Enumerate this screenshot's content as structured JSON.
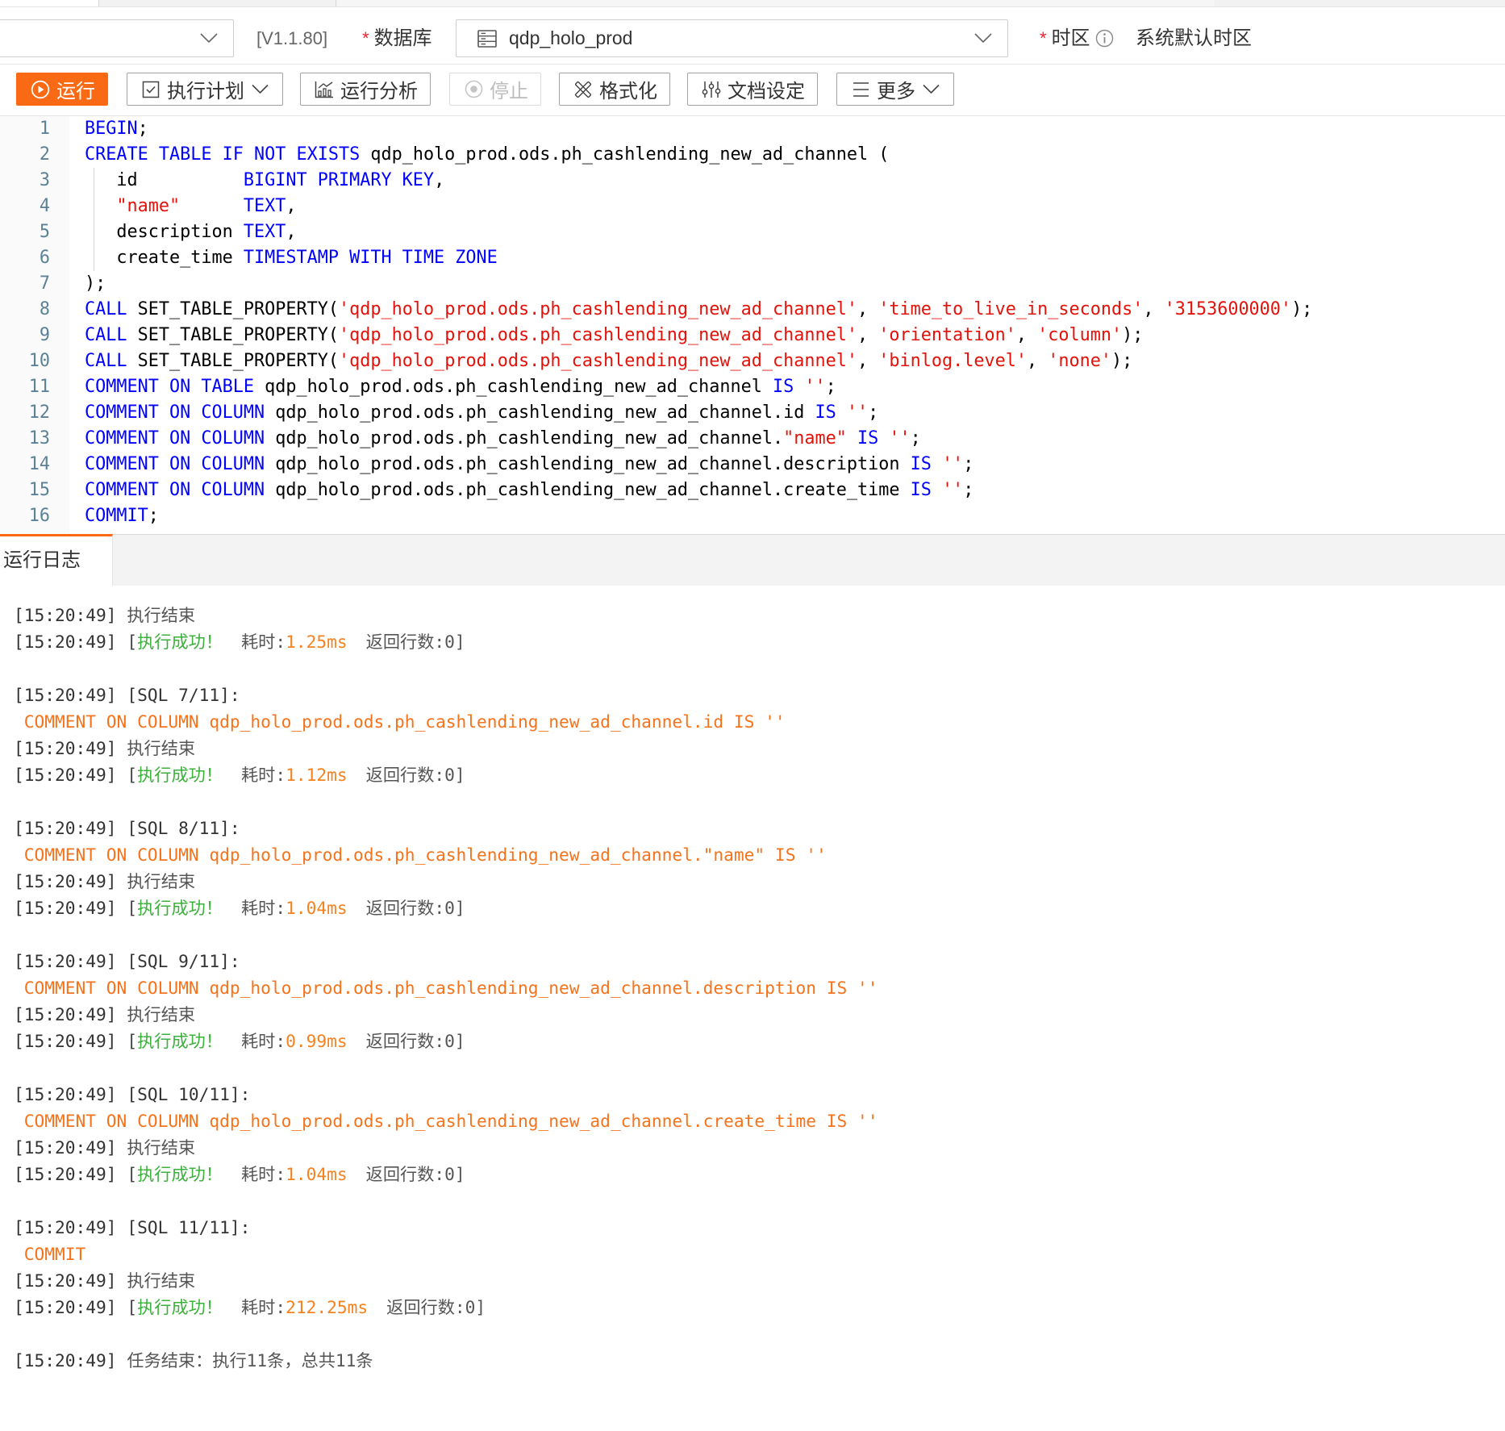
{
  "header": {
    "project_select": {
      "value": ""
    },
    "version": "[V1.1.80]",
    "database": {
      "required_mark": "*",
      "label": "数据库",
      "value": "qdp_holo_prod",
      "icon": "database-icon"
    },
    "timezone": {
      "required_mark": "*",
      "label": "时区",
      "info_icon": "info-icon",
      "value": "系统默认时区"
    }
  },
  "toolbar": {
    "run": {
      "label": "运行",
      "icon": "play-circle-icon"
    },
    "plan": {
      "label": "执行计划",
      "icon": "checkbox-icon"
    },
    "analyze": {
      "label": "运行分析",
      "icon": "chart-icon"
    },
    "stop": {
      "label": "停止",
      "icon": "stop-circle-icon",
      "disabled": true
    },
    "format": {
      "label": "格式化",
      "icon": "format-icon"
    },
    "doc_settings": {
      "label": "文档设定",
      "icon": "sliders-icon"
    },
    "more": {
      "label": "更多",
      "icon": "menu-icon"
    }
  },
  "editor": {
    "lines": [
      {
        "n": 1,
        "tokens": [
          {
            "k": "BEGIN"
          },
          {
            "t": ";"
          }
        ]
      },
      {
        "n": 2,
        "tokens": [
          {
            "k": "CREATE TABLE IF NOT EXISTS"
          },
          {
            "t": " qdp_holo_prod.ods.ph_cashlending_new_ad_channel ("
          }
        ]
      },
      {
        "n": 3,
        "tokens": [
          {
            "t": "   id          "
          },
          {
            "k": "BIGINT PRIMARY KEY"
          },
          {
            "t": ","
          }
        ]
      },
      {
        "n": 4,
        "tokens": [
          {
            "t": "   "
          },
          {
            "s": "\"name\""
          },
          {
            "t": "      "
          },
          {
            "k": "TEXT"
          },
          {
            "t": ","
          }
        ]
      },
      {
        "n": 5,
        "tokens": [
          {
            "t": "   description "
          },
          {
            "k": "TEXT"
          },
          {
            "t": ","
          }
        ]
      },
      {
        "n": 6,
        "tokens": [
          {
            "t": "   create_time "
          },
          {
            "k": "TIMESTAMP WITH TIME ZONE"
          }
        ]
      },
      {
        "n": 7,
        "tokens": [
          {
            "t": ");"
          }
        ]
      },
      {
        "n": 8,
        "tokens": [
          {
            "k": "CALL"
          },
          {
            "t": " SET_TABLE_PROPERTY("
          },
          {
            "s": "'qdp_holo_prod.ods.ph_cashlending_new_ad_channel'"
          },
          {
            "t": ", "
          },
          {
            "s": "'time_to_live_in_seconds'"
          },
          {
            "t": ", "
          },
          {
            "s": "'3153600000'"
          },
          {
            "t": ");"
          }
        ]
      },
      {
        "n": 9,
        "tokens": [
          {
            "k": "CALL"
          },
          {
            "t": " SET_TABLE_PROPERTY("
          },
          {
            "s": "'qdp_holo_prod.ods.ph_cashlending_new_ad_channel'"
          },
          {
            "t": ", "
          },
          {
            "s": "'orientation'"
          },
          {
            "t": ", "
          },
          {
            "s": "'column'"
          },
          {
            "t": ");"
          }
        ]
      },
      {
        "n": 10,
        "tokens": [
          {
            "k": "CALL"
          },
          {
            "t": " SET_TABLE_PROPERTY("
          },
          {
            "s": "'qdp_holo_prod.ods.ph_cashlending_new_ad_channel'"
          },
          {
            "t": ", "
          },
          {
            "s": "'binlog.level'"
          },
          {
            "t": ", "
          },
          {
            "s": "'none'"
          },
          {
            "t": ");"
          }
        ]
      },
      {
        "n": 11,
        "tokens": [
          {
            "k": "COMMENT ON TABLE"
          },
          {
            "t": " qdp_holo_prod.ods.ph_cashlending_new_ad_channel "
          },
          {
            "k": "IS"
          },
          {
            "t": " "
          },
          {
            "s": "''"
          },
          {
            "t": ";"
          }
        ]
      },
      {
        "n": 12,
        "tokens": [
          {
            "k": "COMMENT ON COLUMN"
          },
          {
            "t": " qdp_holo_prod.ods.ph_cashlending_new_ad_channel.id "
          },
          {
            "k": "IS"
          },
          {
            "t": " "
          },
          {
            "s": "''"
          },
          {
            "t": ";"
          }
        ]
      },
      {
        "n": 13,
        "tokens": [
          {
            "k": "COMMENT ON COLUMN"
          },
          {
            "t": " qdp_holo_prod.ods.ph_cashlending_new_ad_channel."
          },
          {
            "s": "\"name\""
          },
          {
            "t": " "
          },
          {
            "k": "IS"
          },
          {
            "t": " "
          },
          {
            "s": "''"
          },
          {
            "t": ";"
          }
        ]
      },
      {
        "n": 14,
        "tokens": [
          {
            "k": "COMMENT ON COLUMN"
          },
          {
            "t": " qdp_holo_prod.ods.ph_cashlending_new_ad_channel.description "
          },
          {
            "k": "IS"
          },
          {
            "t": " "
          },
          {
            "s": "''"
          },
          {
            "t": ";"
          }
        ]
      },
      {
        "n": 15,
        "tokens": [
          {
            "k": "COMMENT ON COLUMN"
          },
          {
            "t": " qdp_holo_prod.ods.ph_cashlending_new_ad_channel.create_time "
          },
          {
            "k": "IS"
          },
          {
            "t": " "
          },
          {
            "s": "''"
          },
          {
            "t": ";"
          }
        ]
      },
      {
        "n": 16,
        "tokens": [
          {
            "k": "COMMIT"
          },
          {
            "t": ";"
          }
        ]
      }
    ]
  },
  "log_panel": {
    "tab_label": "运行日志",
    "entries": [
      {
        "time": "[15:20:49]",
        "msg": "执行结束"
      },
      {
        "time": "[15:20:49]",
        "open": "[",
        "status": "执行成功！",
        "elapsed_label": "耗时:",
        "elapsed": "1.25ms",
        "rows": "返回行数:0]"
      },
      {},
      {
        "time": "[15:20:49]",
        "sql": "[SQL 7/11]:"
      },
      {
        "stmt": "COMMENT ON COLUMN qdp_holo_prod.ods.ph_cashlending_new_ad_channel.id IS ''"
      },
      {
        "time": "[15:20:49]",
        "msg": "执行结束"
      },
      {
        "time": "[15:20:49]",
        "open": "[",
        "status": "执行成功！",
        "elapsed_label": "耗时:",
        "elapsed": "1.12ms",
        "rows": "返回行数:0]"
      },
      {},
      {
        "time": "[15:20:49]",
        "sql": "[SQL 8/11]:"
      },
      {
        "stmt": "COMMENT ON COLUMN qdp_holo_prod.ods.ph_cashlending_new_ad_channel.\"name\" IS ''"
      },
      {
        "time": "[15:20:49]",
        "msg": "执行结束"
      },
      {
        "time": "[15:20:49]",
        "open": "[",
        "status": "执行成功！",
        "elapsed_label": "耗时:",
        "elapsed": "1.04ms",
        "rows": "返回行数:0]"
      },
      {},
      {
        "time": "[15:20:49]",
        "sql": "[SQL 9/11]:"
      },
      {
        "stmt": "COMMENT ON COLUMN qdp_holo_prod.ods.ph_cashlending_new_ad_channel.description IS ''"
      },
      {
        "time": "[15:20:49]",
        "msg": "执行结束"
      },
      {
        "time": "[15:20:49]",
        "open": "[",
        "status": "执行成功！",
        "elapsed_label": "耗时:",
        "elapsed": "0.99ms",
        "rows": "返回行数:0]"
      },
      {},
      {
        "time": "[15:20:49]",
        "sql": "[SQL 10/11]:"
      },
      {
        "stmt": "COMMENT ON COLUMN qdp_holo_prod.ods.ph_cashlending_new_ad_channel.create_time IS ''"
      },
      {
        "time": "[15:20:49]",
        "msg": "执行结束"
      },
      {
        "time": "[15:20:49]",
        "open": "[",
        "status": "执行成功！",
        "elapsed_label": "耗时:",
        "elapsed": "1.04ms",
        "rows": "返回行数:0]"
      },
      {},
      {
        "time": "[15:20:49]",
        "sql": "[SQL 11/11]:"
      },
      {
        "stmt": "COMMIT"
      },
      {
        "time": "[15:20:49]",
        "msg": "执行结束"
      },
      {
        "time": "[15:20:49]",
        "open": "[",
        "status": "执行成功！",
        "elapsed_label": "耗时:",
        "elapsed": "212.25ms",
        "rows": "返回行数:0]"
      },
      {},
      {
        "time": "[15:20:49]",
        "msg": "任务结束：执行11条，总共11条"
      }
    ]
  },
  "theme": {
    "accent": "#fa6a14",
    "required": "#f5222d",
    "keyword": "#0000ff",
    "string": "#e3120b",
    "plain": "#000000",
    "line_number": "#5d8196",
    "success": "#3bb13b",
    "elapsed": "#f5821f",
    "sql_log": "#f5731c"
  }
}
